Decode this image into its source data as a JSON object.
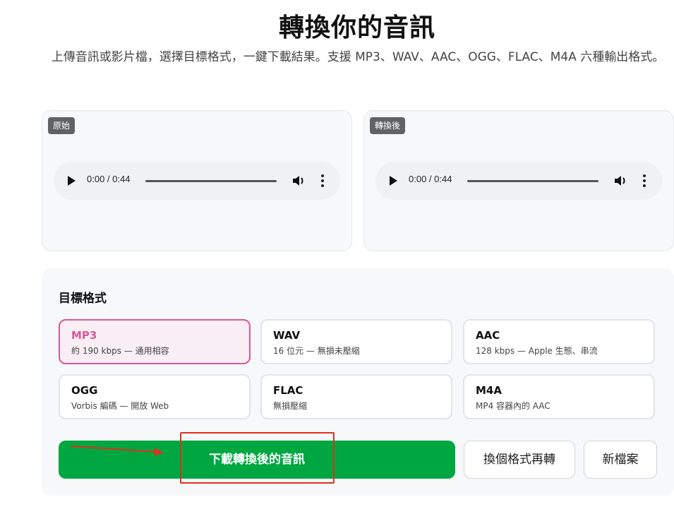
{
  "header": {
    "title": "轉換你的音訊",
    "subtitle": "上傳音訊或影片檔，選擇目標格式，一鍵下載結果。支援 MP3、WAV、AAC、OGG、FLAC、M4A 六種輸出格式。"
  },
  "previews": {
    "original": {
      "tag": "原始",
      "time": "0:00 / 0:44"
    },
    "converted": {
      "tag": "轉換後",
      "time": "0:00 / 0:44"
    }
  },
  "format_panel": {
    "title": "目標格式",
    "selected": "MP3",
    "formats": [
      {
        "name": "MP3",
        "desc": "約 190 kbps — 通用相容"
      },
      {
        "name": "WAV",
        "desc": "16 位元 — 無損未壓縮"
      },
      {
        "name": "AAC",
        "desc": "128 kbps — Apple 生態、串流"
      },
      {
        "name": "OGG",
        "desc": "Vorbis 編碼 — 開放 Web"
      },
      {
        "name": "FLAC",
        "desc": "無損壓縮"
      },
      {
        "name": "M4A",
        "desc": "MP4 容器內的 AAC"
      }
    ]
  },
  "actions": {
    "download": "下載轉換後的音訊",
    "reconvert": "換個格式再轉",
    "new_file": "新檔案"
  },
  "colors": {
    "accent_green": "#00a640",
    "selected_pink": "#d9579b",
    "annotation_red": "#e0301e"
  }
}
